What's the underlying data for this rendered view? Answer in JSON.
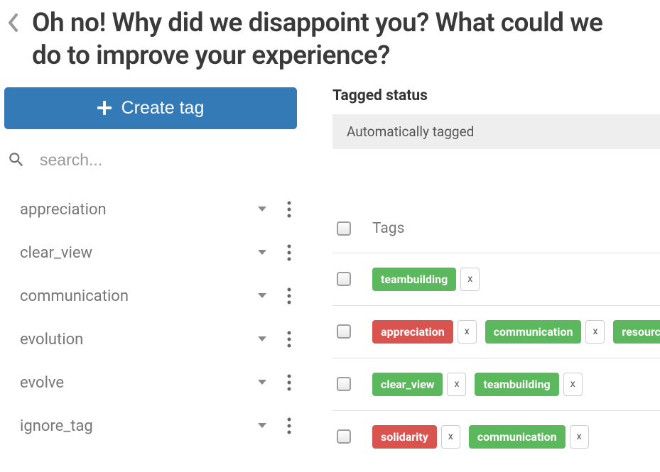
{
  "page_title": "Oh no! Why did we disappoint you? What could we do to improve your experience?",
  "create_tag_label": "Create tag",
  "search_placeholder": "search...",
  "sidebar_tags": [
    {
      "name": "appreciation"
    },
    {
      "name": "clear_view"
    },
    {
      "name": "communication"
    },
    {
      "name": "evolution"
    },
    {
      "name": "evolve"
    },
    {
      "name": "ignore_tag"
    }
  ],
  "tagged_status_heading": "Tagged status",
  "tagged_status_value": "Automatically tagged",
  "tags_column_header": "Tags",
  "rows": [
    {
      "chips": [
        {
          "label": "teambuilding",
          "color": "green",
          "removable": true
        }
      ]
    },
    {
      "chips": [
        {
          "label": "appreciation",
          "color": "red",
          "removable": true
        },
        {
          "label": "communication",
          "color": "green",
          "removable": true
        },
        {
          "label": "resources",
          "color": "green",
          "removable": false
        }
      ]
    },
    {
      "chips": [
        {
          "label": "clear_view",
          "color": "green",
          "removable": true
        },
        {
          "label": "teambuilding",
          "color": "green",
          "removable": true
        }
      ]
    },
    {
      "chips": [
        {
          "label": "solidarity",
          "color": "red",
          "removable": true
        },
        {
          "label": "communication",
          "color": "green",
          "removable": true
        }
      ]
    }
  ]
}
